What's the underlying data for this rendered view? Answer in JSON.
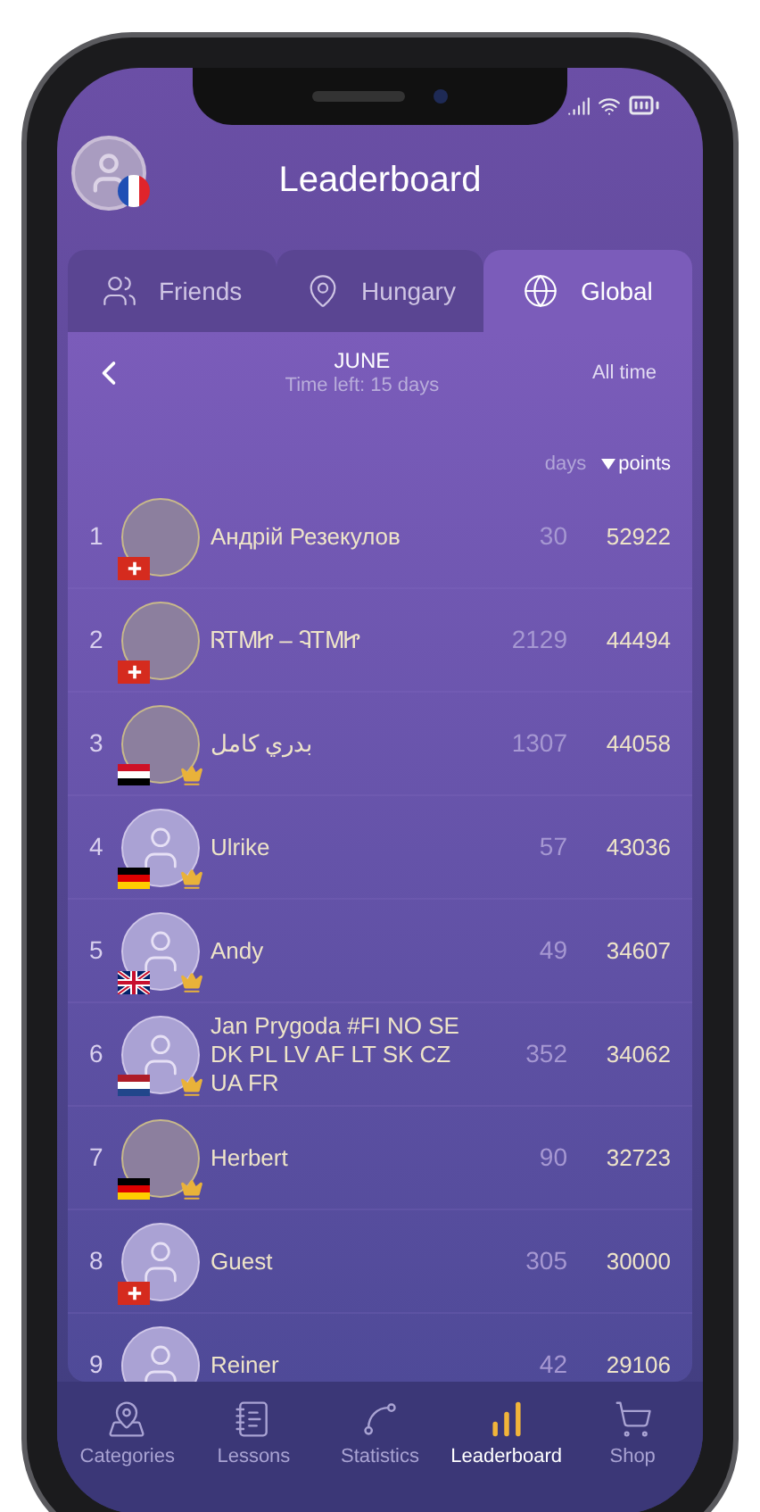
{
  "header": {
    "title": "Leaderboard",
    "profile_flag": {
      "kind": "fr"
    }
  },
  "tabs": [
    {
      "label": "Friends",
      "selected": false
    },
    {
      "label": "Hungary",
      "selected": false
    },
    {
      "label": "Global",
      "selected": true
    }
  ],
  "period": {
    "month": "JUNE",
    "time_left": "Time left: 15 days",
    "all_time": "All time"
  },
  "columns": [
    {
      "label": "days",
      "sorted": false
    },
    {
      "label": "points",
      "sorted": true
    }
  ],
  "rows": [
    {
      "rank": "1",
      "name": "Андрій Резекулов",
      "days": "30",
      "points": "52922",
      "photo": true,
      "flag": {
        "kind": "ch"
      },
      "crown": false
    },
    {
      "rank": "2",
      "name": "ᏒᎢᎷᏥ – ᎸᎢᎷᏥ",
      "days": "2129",
      "points": "44494",
      "photo": true,
      "flag": {
        "kind": "ch"
      },
      "crown": false
    },
    {
      "rank": "3",
      "name": "بدري كامل",
      "days": "1307",
      "points": "44058",
      "photo": true,
      "flag": {
        "kind": "eg"
      },
      "crown": true
    },
    {
      "rank": "4",
      "name": "Ulrike",
      "days": "57",
      "points": "43036",
      "photo": false,
      "flag": {
        "kind": "de"
      },
      "crown": true
    },
    {
      "rank": "5",
      "name": "Andy",
      "days": "49",
      "points": "34607",
      "photo": false,
      "flag": {
        "kind": "gb"
      },
      "crown": true
    },
    {
      "rank": "6",
      "name": "Jan Prygoda #FI NO SE DK PL LV AF LT SK CZ UA FR",
      "days": "352",
      "points": "34062",
      "photo": false,
      "flag": {
        "kind": "nl"
      },
      "crown": true
    },
    {
      "rank": "7",
      "name": "Herbert",
      "days": "90",
      "points": "32723",
      "photo": true,
      "flag": {
        "kind": "de"
      },
      "crown": true
    },
    {
      "rank": "8",
      "name": "Guest",
      "days": "305",
      "points": "30000",
      "photo": false,
      "flag": {
        "kind": "ch"
      },
      "crown": false
    },
    {
      "rank": "9",
      "name": "Reiner",
      "days": "42",
      "points": "29106",
      "photo": false,
      "crown": false
    }
  ],
  "nav": [
    {
      "label": "Categories",
      "selected": false
    },
    {
      "label": "Lessons",
      "selected": false
    },
    {
      "label": "Statistics",
      "selected": false
    },
    {
      "label": "Leaderboard",
      "selected": true
    },
    {
      "label": "Shop",
      "selected": false
    }
  ]
}
